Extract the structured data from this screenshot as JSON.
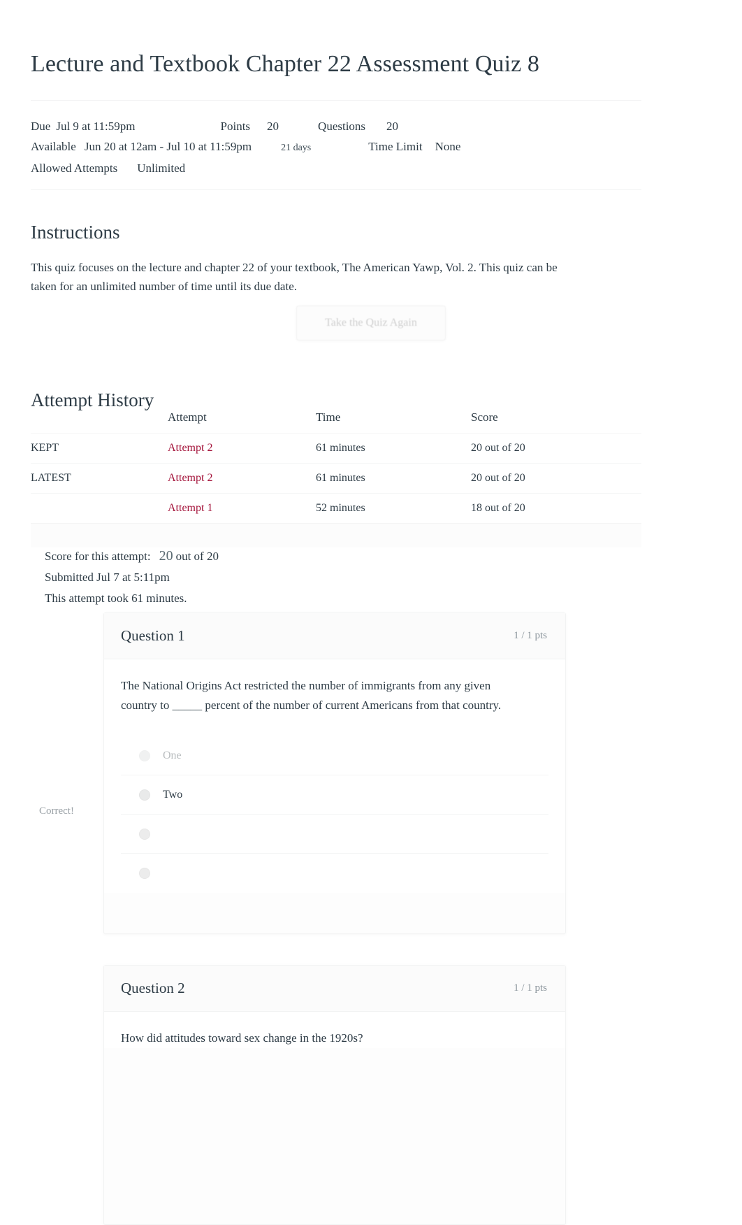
{
  "page": {
    "title": "Lecture and Textbook Chapter 22 Assessment Quiz 8"
  },
  "meta": {
    "due_label": "Due",
    "due_value": "Jul 9 at 11:59pm",
    "points_label": "Points",
    "points_value": "20",
    "questions_label": "Questions",
    "questions_value": "20",
    "available_label": "Available",
    "available_value": "Jun 20 at 12am - Jul 10 at 11:59pm",
    "available_days": "21 days",
    "time_limit_label": "Time Limit",
    "time_limit_value": "None",
    "allowed_attempts_label": "Allowed Attempts",
    "allowed_attempts_value": "Unlimited"
  },
  "instructions": {
    "heading": "Instructions",
    "body": "This quiz focuses on the lecture and chapter 22 of your textbook, The American Yawp, Vol. 2. This quiz can be taken for an unlimited number of time until its due date."
  },
  "retake": {
    "label": "Take the Quiz Again"
  },
  "attempt_history": {
    "heading": "Attempt History",
    "columns": {
      "status": "",
      "attempt": "Attempt",
      "time": "Time",
      "score": "Score"
    },
    "rows": [
      {
        "status": "KEPT",
        "attempt": "Attempt 2",
        "time": "61 minutes",
        "score": "20 out of 20"
      },
      {
        "status": "LATEST",
        "attempt": "Attempt 2",
        "time": "61 minutes",
        "score": "20 out of 20"
      },
      {
        "status": "",
        "attempt": "Attempt 1",
        "time": "52 minutes",
        "score": "18 out of 20"
      }
    ]
  },
  "score_summary": {
    "score_label": "Score for this attempt:",
    "score_value": "20",
    "score_suffix": "out of 20",
    "submitted": "Submitted Jul 7 at 5:11pm",
    "duration": "This attempt took 61 minutes."
  },
  "questions": [
    {
      "name": "Question 1",
      "points": "1 / 1 pts",
      "text": "The National Origins Act restricted the number of immigrants from any given country to _____ percent of the number of current Americans from that country.",
      "correct_tag": "Correct!",
      "answers": [
        {
          "label": "One",
          "state": "faded"
        },
        {
          "label": "Two",
          "state": "selected"
        },
        {
          "label": "",
          "state": "blank"
        },
        {
          "label": "",
          "state": "blank"
        }
      ]
    },
    {
      "name": "Question 2",
      "points": "1 / 1 pts",
      "text": "How did attitudes toward sex change in the 1920s?",
      "correct_tag": "",
      "answers": []
    }
  ],
  "colors": {
    "link": "#a4133a",
    "text": "#2d3b45",
    "muted": "#8a949b"
  }
}
